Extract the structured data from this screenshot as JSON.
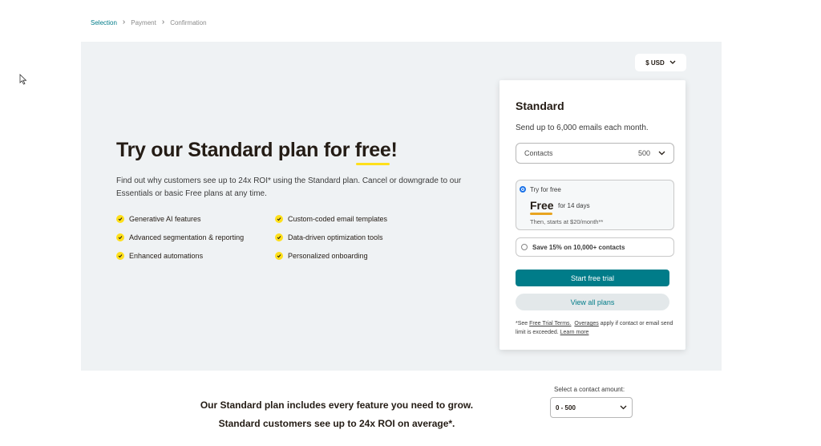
{
  "breadcrumb": {
    "items": [
      "Selection",
      "Payment",
      "Confirmation"
    ]
  },
  "currency": {
    "label": "$ USD"
  },
  "hero": {
    "headline_prefix": "Try our Standard plan for ",
    "headline_highlight": "free",
    "headline_suffix": "!",
    "subtext": "Find out why customers see up to 24x ROI* using the Standard plan. Cancel or downgrade to our Essentials or basic Free plans at any time.",
    "features_col1": [
      "Generative AI features",
      "Advanced segmentation & reporting",
      "Enhanced automations"
    ],
    "features_col2": [
      "Custom-coded email templates",
      "Data-driven optimization tools",
      "Personalized onboarding"
    ]
  },
  "card": {
    "title": "Standard",
    "subtitle": "Send up to 6,000 emails each month.",
    "contacts_label": "Contacts",
    "contacts_value": "500",
    "trial_option": {
      "label": "Try for free",
      "price": "Free",
      "duration": "for 14 days",
      "then": "Then, starts at $20/month**"
    },
    "save_option": {
      "label": "Save 15% on 10,000+ contacts"
    },
    "primary_button": "Start free trial",
    "secondary_button": "View all plans",
    "footnote": {
      "prefix": "*See ",
      "link1": "Free Trial Terms.",
      "link2": "Overages",
      "middle": " apply if contact or email send limit is exceeded. ",
      "link3": "Learn more"
    }
  },
  "bottom": {
    "line1": "Our Standard plan includes every feature you need to grow.",
    "line2": "Standard customers see up to 24x ROI on average*.",
    "amount_label": "Select a contact amount:",
    "amount_value": "0 - 500"
  },
  "colors": {
    "accent": "#007c89",
    "highlight": "#ffe01b",
    "hero_bg": "#eff2f4"
  }
}
